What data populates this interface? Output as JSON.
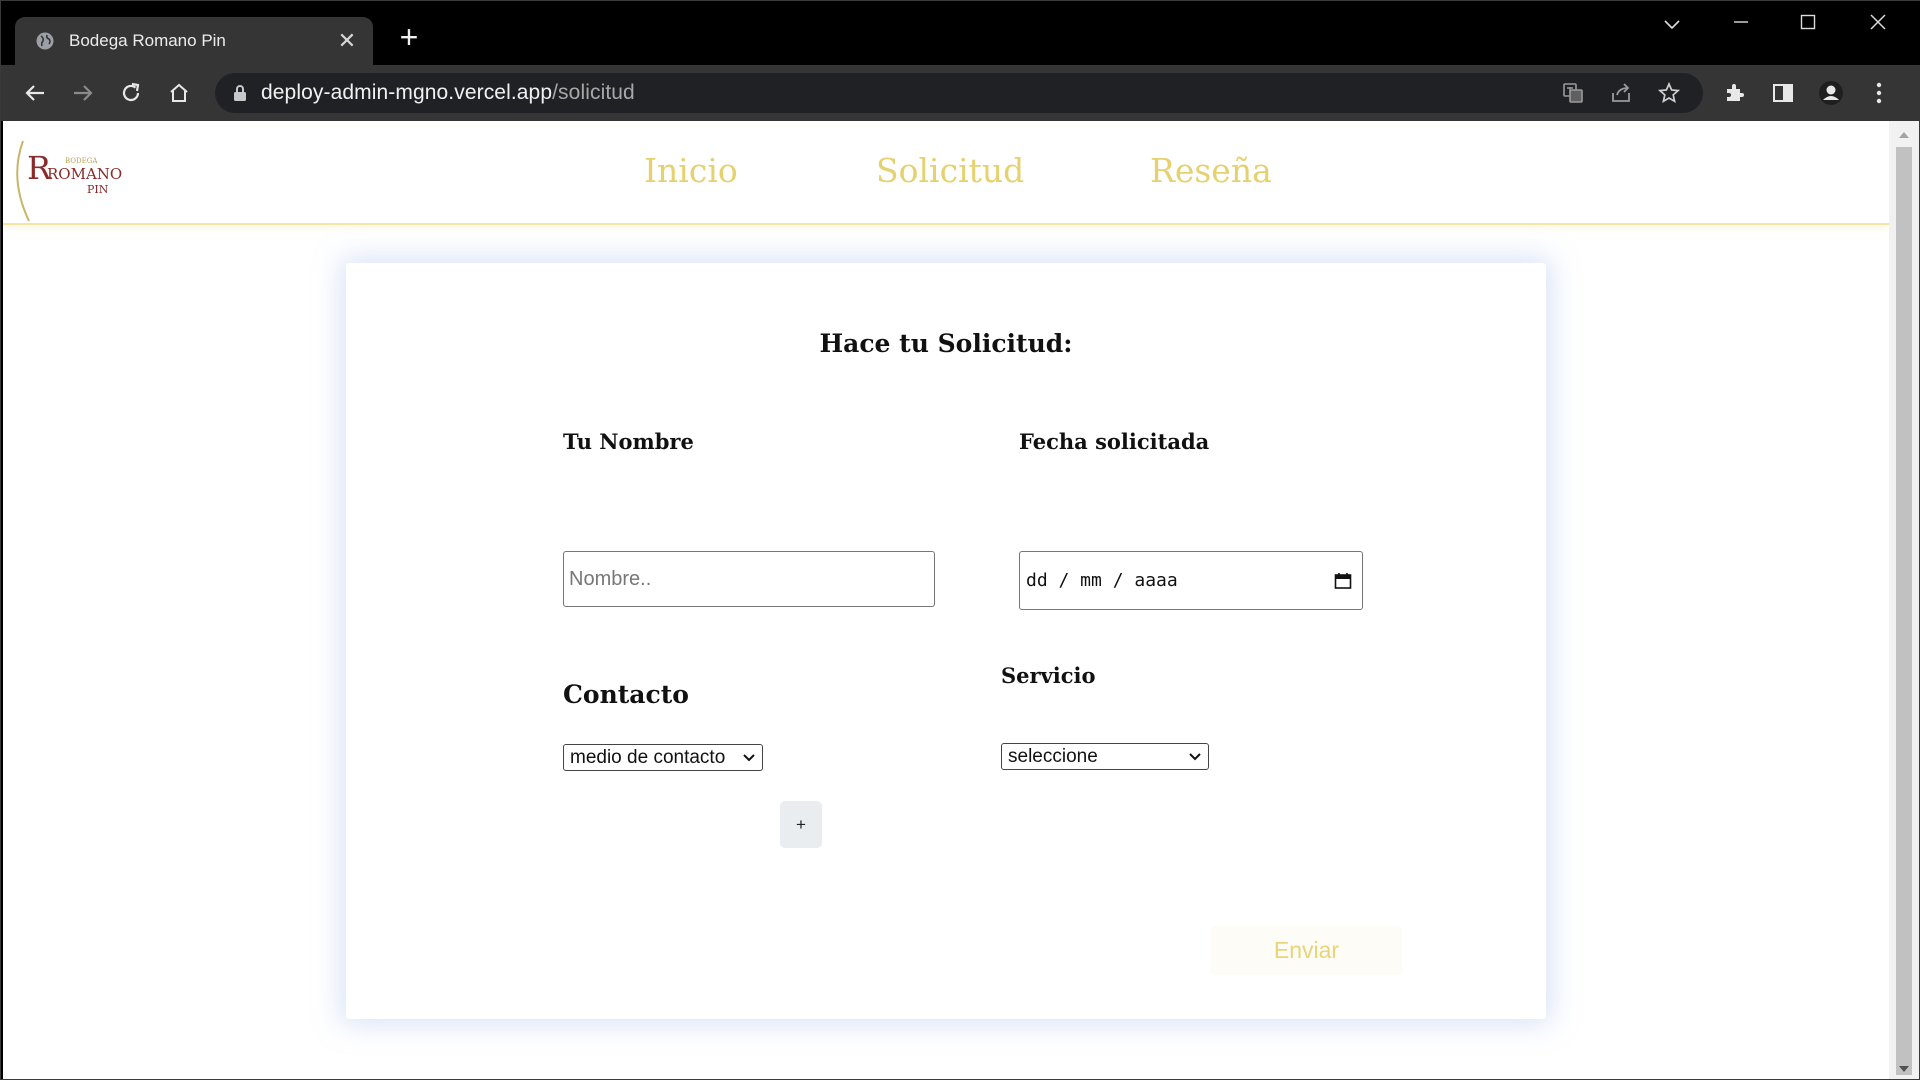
{
  "browser": {
    "tab_title": "Bodega Romano Pin",
    "url_host": "deploy-admin-mgno.vercel.app",
    "url_path": "/solicitud"
  },
  "site": {
    "logo": {
      "line_small": "BODEGA",
      "line_main": "ROMANO",
      "line_sub": "PIN"
    },
    "nav": [
      {
        "label": "Inicio"
      },
      {
        "label": "Solicitud"
      },
      {
        "label": "Reseña"
      }
    ],
    "accent_color": "#e6d170"
  },
  "form": {
    "title": "Hace tu Solicitud:",
    "name_label": "Tu Nombre",
    "name_placeholder": "Nombre..",
    "date_label": "Fecha solicitada",
    "date_value": "dd / mm / aaaa",
    "contact_label": "Contacto",
    "contact_select": "medio de contacto",
    "service_label": "Servicio",
    "service_select": "seleccione",
    "add_label": "+",
    "submit_label": "Enviar"
  }
}
